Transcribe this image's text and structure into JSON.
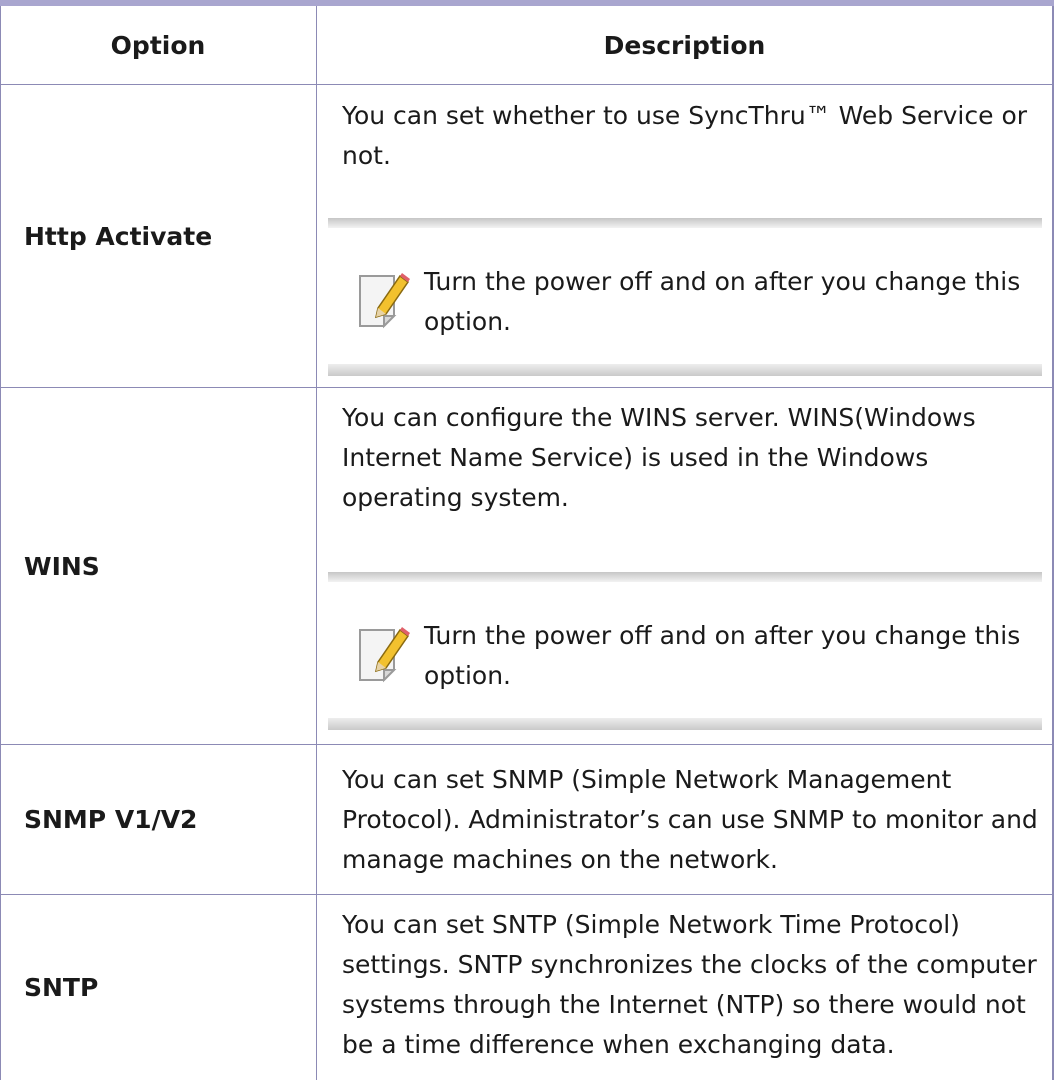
{
  "table": {
    "header": {
      "option": "Option",
      "description": "Description"
    },
    "rows": [
      {
        "option": "Http Activate",
        "description": "You can set whether to use SyncThru™ Web Service or not.",
        "note": "Turn the power off and on after you change this option."
      },
      {
        "option": "WINS",
        "description": "You can configure the WINS server. WINS(Windows Internet Name Service) is used in the Windows operating system.",
        "note": "Turn the power off and on after you change this option."
      },
      {
        "option": "SNMP V1/V2",
        "description": "You can set SNMP (Simple Network Management Protocol). Administrator’s can use SNMP to monitor and manage machines on the network."
      },
      {
        "option": "SNTP",
        "description": "You can set SNTP (Simple Network Time Protocol) settings. SNTP synchronizes the clocks of the computer systems through the Internet (NTP) so there would not be a time difference when exchanging data."
      }
    ]
  },
  "icons": {
    "note": "note-pencil-icon"
  },
  "colors": {
    "header_rule": "#a9a6cf",
    "border": "#8c8ab5"
  }
}
